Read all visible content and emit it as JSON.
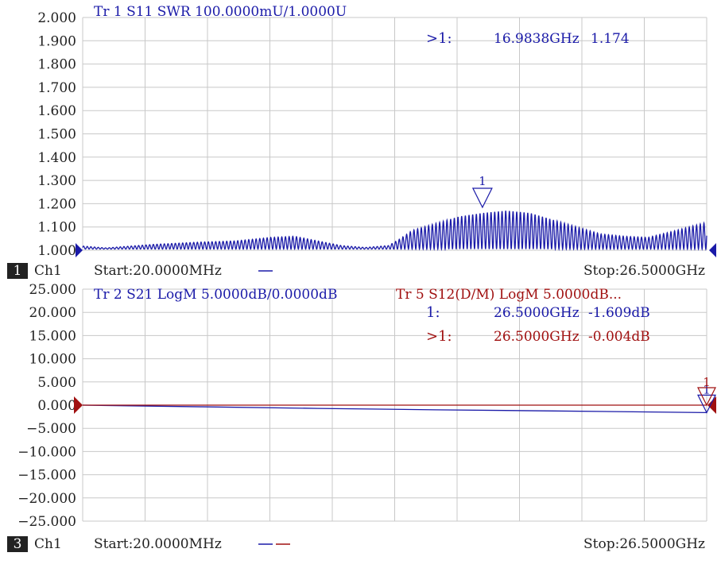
{
  "colors": {
    "trace_blue": "#1a1aa8",
    "trace_red": "#a01010",
    "grid": "#c8c8c8",
    "text": "#222222"
  },
  "chart_data": [
    {
      "type": "line",
      "panel": "upper",
      "trace_header": "Tr 1   S11 SWR 100.0000mU/1.0000U",
      "x_range_ghz": [
        0.02,
        26.5
      ],
      "ylim": [
        1.0,
        2.0
      ],
      "y_ticks": [
        "2.000",
        "1.900",
        "1.800",
        "1.700",
        "1.600",
        "1.500",
        "1.400",
        "1.300",
        "1.200",
        "1.100",
        "1.000"
      ],
      "x_divisions": 10,
      "series": [
        {
          "color": "#1a1aa8",
          "envelope_x_ghz": [
            0.02,
            1.0,
            3.0,
            5.0,
            6.5,
            8.0,
            9.0,
            10.0,
            11.0,
            12.0,
            13.0,
            13.5,
            14.0,
            15.0,
            16.0,
            17.0,
            18.0,
            19.0,
            20.0,
            21.0,
            22.0,
            23.0,
            24.0,
            25.0,
            26.5
          ],
          "envelope_y": [
            1.018,
            1.01,
            1.025,
            1.035,
            1.04,
            1.055,
            1.06,
            1.04,
            1.02,
            1.012,
            1.02,
            1.05,
            1.085,
            1.115,
            1.145,
            1.16,
            1.17,
            1.16,
            1.13,
            1.1,
            1.07,
            1.06,
            1.055,
            1.08,
            1.12
          ],
          "baseline": 1.005,
          "ripple_periods": 170
        }
      ],
      "markers": [
        {
          "number": "1",
          "active": true,
          "readout_prefix": ">1:",
          "x_ghz": 16.9838,
          "value": 1.174,
          "freq_text": "16.9838GHz",
          "value_text": "1.174",
          "color": "#1a1aa8"
        }
      ],
      "footer": {
        "channel_number": "1",
        "channel": "Ch1",
        "start": "Start:20.0000MHz",
        "stop": "Stop:26.5000GHz",
        "legend_dash_colors": [
          "#1a1aa8"
        ]
      }
    },
    {
      "type": "line",
      "panel": "lower",
      "trace_headers": [
        {
          "text": "Tr 2   S21 LogM 5.0000dB/0.0000dB",
          "color": "#1a1aa8"
        },
        {
          "text": "Tr 5   S12(D/M) LogM 5.0000dB...",
          "color": "#a01010"
        }
      ],
      "x_range_ghz": [
        0.02,
        26.5
      ],
      "ylim": [
        -25.0,
        25.0
      ],
      "y_ticks": [
        "25.000",
        "20.000",
        "15.000",
        "10.000",
        "5.000",
        "0.000",
        "−10.000",
        "−15.000",
        "−20.000",
        "−25.000"
      ],
      "y_tick_values": [
        25,
        20,
        15,
        10,
        5,
        0,
        -10,
        -15,
        -20,
        -25
      ],
      "extra_tick": {
        "text": "−5.000",
        "value": -5
      },
      "x_divisions": 10,
      "series": [
        {
          "color": "#1a1aa8",
          "x_ghz": [
            0.02,
            5.0,
            10.0,
            15.0,
            20.0,
            26.5
          ],
          "y_db": [
            0.0,
            -0.35,
            -0.7,
            -1.0,
            -1.25,
            -1.609
          ]
        },
        {
          "color": "#a01010",
          "x_ghz": [
            0.02,
            26.5
          ],
          "y_db": [
            0.0,
            -0.004
          ]
        }
      ],
      "markers": [
        {
          "number": "1",
          "readout_prefix": "1:",
          "x_ghz": 26.5,
          "value": -1.609,
          "freq_text": "26.5000GHz",
          "value_text": "-1.609dB",
          "color": "#1a1aa8"
        },
        {
          "number": "1",
          "readout_prefix": ">1:",
          "x_ghz": 26.5,
          "value": -0.004,
          "freq_text": "26.5000GHz",
          "value_text": "-0.004dB",
          "color": "#a01010"
        }
      ],
      "footer": {
        "channel_number": "3",
        "channel": "Ch1",
        "start": "Start:20.0000MHz",
        "stop": "Stop:26.5000GHz",
        "legend_dash_colors": [
          "#1a1aa8",
          "#a01010"
        ]
      }
    }
  ]
}
